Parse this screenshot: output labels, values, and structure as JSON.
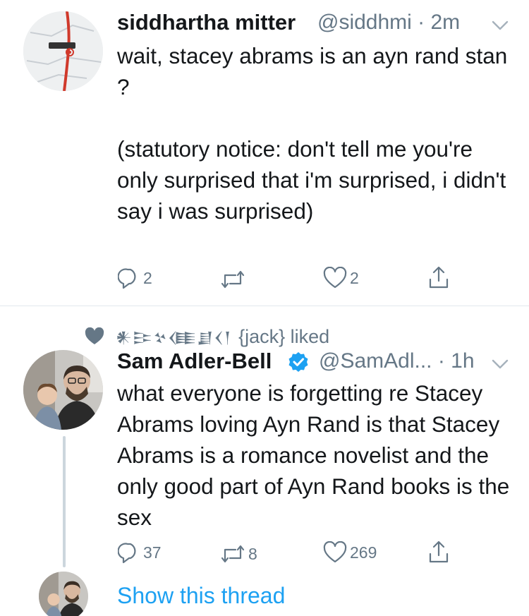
{
  "tweet1": {
    "display_name": "siddhartha mitter",
    "handle_time": "@siddhmi · 2m",
    "text": "wait, stacey abrams is an ayn rand stan ?\n\n(statutory notice: don't tell me you're only surprised that i'm surprised, i didn't say i was surprised)",
    "replies": "2",
    "retweets": "",
    "likes": "2"
  },
  "tweet2": {
    "liked_by_glyphs": "𒀭𒄿𒆳𒈪𒋗𒌋𒁹",
    "liked_by_text": "{jack} liked",
    "display_name": "Sam Adler-Bell",
    "handle_time": "@SamAdl... · 1h",
    "text": "what everyone is forgetting re Stacey Abrams loving Ayn Rand is that Stacey Abrams is a romance novelist and the only good part of Ayn Rand books is the sex",
    "replies": "37",
    "retweets": "8",
    "likes": "269"
  },
  "show_thread": "Show this thread",
  "colors": {
    "link": "#1da1f2",
    "secondary": "#657786",
    "verified": "#1da1f2"
  },
  "icons": [
    "reply-icon",
    "retweet-icon",
    "like-icon",
    "share-icon",
    "chevron-down-icon",
    "heart-filled-icon",
    "verified-badge-icon"
  ]
}
